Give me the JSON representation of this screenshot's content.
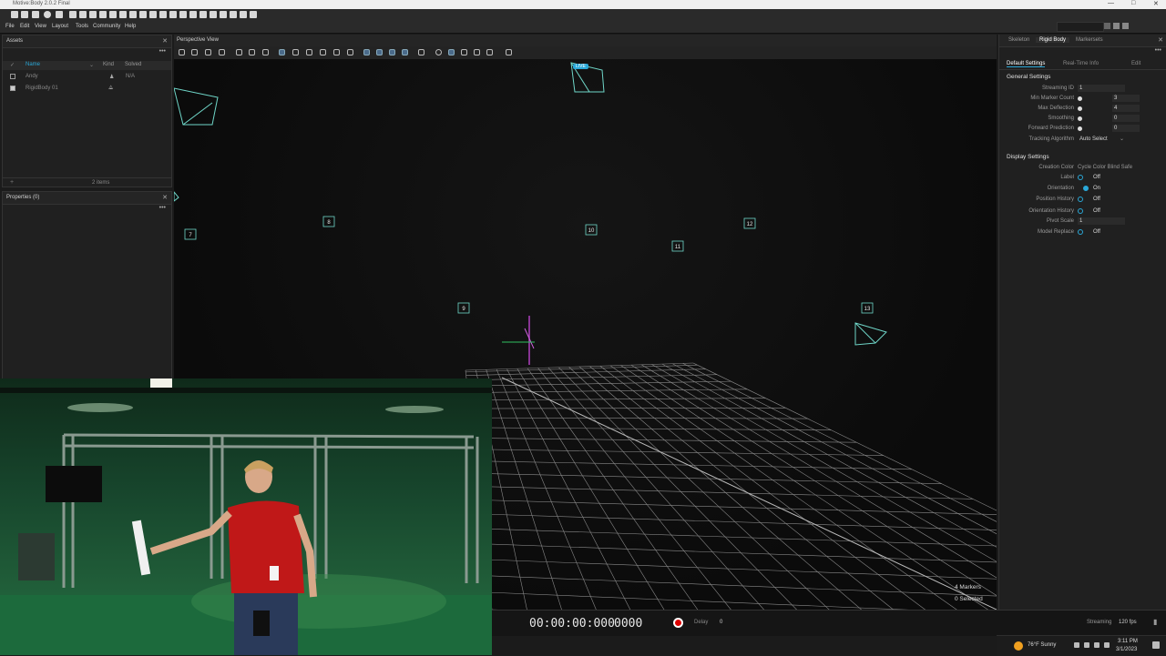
{
  "window": {
    "title": "Motive:Body 2.0.2 Final"
  },
  "menu": [
    "File",
    "Edit",
    "View",
    "Layout",
    "Tools",
    "Community",
    "Help"
  ],
  "assets": {
    "title": "Assets",
    "columns": {
      "name": "Name",
      "kind": "Kind",
      "solved": "Solved"
    },
    "rows": [
      {
        "name": "Andy",
        "kind": "person-icon",
        "solved": "N/A",
        "checked": false
      },
      {
        "name": "RigidBody 01",
        "kind": "rigidbody-icon",
        "solved": "",
        "checked": true
      }
    ],
    "footer_count": "2 items"
  },
  "properties": {
    "title": "Properties (0)"
  },
  "viewport": {
    "title": "Perspective View",
    "live_badge": "LIVE",
    "camera_labels": [
      "7",
      "8",
      "9",
      "10",
      "11",
      "12",
      "13"
    ],
    "markers_text": "4 Markers",
    "selected_text": "0 Selected"
  },
  "timeline": {
    "timecode": "00:00:00:000",
    "frame": "0000",
    "delay_label": "Delay",
    "delay_value": "0"
  },
  "status": {
    "streaming_label": "Streaming",
    "fps": "120 fps"
  },
  "taskbar": {
    "weather": "76°F  Sunny",
    "time": "3:11 PM",
    "date": "3/1/2023"
  },
  "right_panel": {
    "tabs": [
      "Skeleton",
      "Rigid Body",
      "Markersets"
    ],
    "active_tab": "Rigid Body",
    "subtabs": [
      "Default Settings",
      "Real-Time Info",
      "Edit"
    ],
    "general_title": "General Settings",
    "general": [
      {
        "label": "Streaming ID",
        "value": "1"
      },
      {
        "label": "Min Marker Count",
        "value": "3"
      },
      {
        "label": "Max Deflection",
        "value": "4"
      },
      {
        "label": "Smoothing",
        "value": "0"
      },
      {
        "label": "Forward Prediction",
        "value": "0"
      },
      {
        "label": "Tracking Algorithm",
        "value": "Auto Select"
      }
    ],
    "display_title": "Display Settings",
    "display": [
      {
        "label": "Creation Color",
        "value": "Cycle Color Blind Safe"
      },
      {
        "label": "Label",
        "value": "Off"
      },
      {
        "label": "Orientation",
        "value": "On"
      },
      {
        "label": "Position History",
        "value": "Off"
      },
      {
        "label": "Orientation History",
        "value": "Off"
      },
      {
        "label": "Pivot Scale",
        "value": "1"
      },
      {
        "label": "Model Replace",
        "value": "Off"
      }
    ]
  },
  "colors": {
    "accent": "#2aa8d8",
    "camera": "#6fd6c8",
    "record": "#dd0000"
  }
}
